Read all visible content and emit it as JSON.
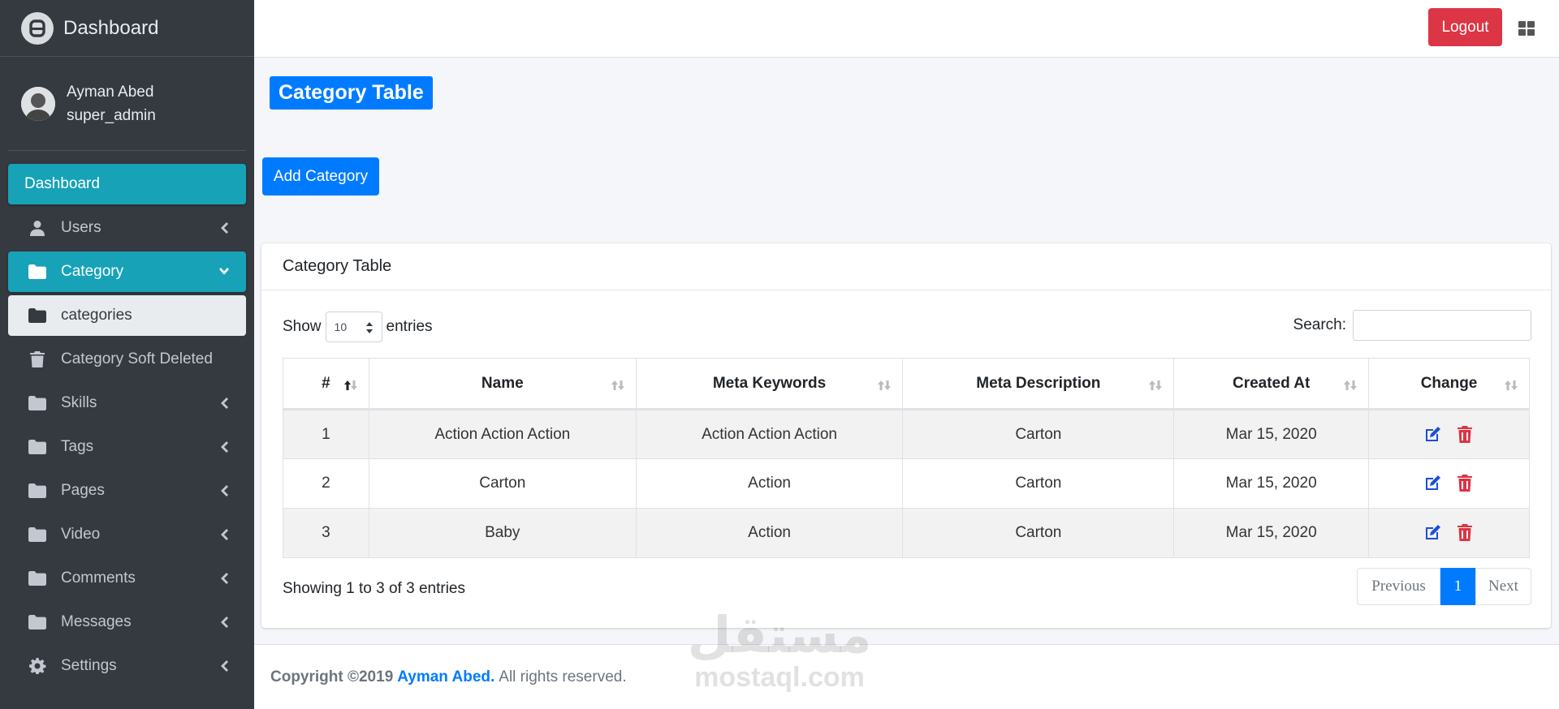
{
  "brand": {
    "name": "Dashboard"
  },
  "user": {
    "name": "Ayman Abed",
    "role": "super_admin"
  },
  "sidebar": {
    "items": [
      {
        "label": "Dashboard"
      },
      {
        "label": "Users"
      },
      {
        "label": "Category"
      },
      {
        "label": "categories"
      },
      {
        "label": "Category Soft Deleted"
      },
      {
        "label": "Skills"
      },
      {
        "label": "Tags"
      },
      {
        "label": "Pages"
      },
      {
        "label": "Video"
      },
      {
        "label": "Comments"
      },
      {
        "label": "Messages"
      },
      {
        "label": "Settings"
      }
    ]
  },
  "header": {
    "logout_label": "Logout"
  },
  "main": {
    "title": "Category Table",
    "add_label": "Add Category",
    "card_title": "Category Table",
    "show_label": "Show",
    "entries_label": "entries",
    "page_length": "10",
    "search_label": "Search:",
    "columns": [
      "#",
      "Name",
      "Meta Keywords",
      "Meta Description",
      "Created At",
      "Change"
    ],
    "rows": [
      {
        "id": "1",
        "name": "Action Action Action",
        "keywords": "Action Action Action",
        "description": "Carton",
        "created": "Mar 15, 2020"
      },
      {
        "id": "2",
        "name": "Carton",
        "keywords": "Action",
        "description": "Carton",
        "created": "Mar 15, 2020"
      },
      {
        "id": "3",
        "name": "Baby",
        "keywords": "Action",
        "description": "Carton",
        "created": "Mar 15, 2020"
      }
    ],
    "info": "Showing 1 to 3 of 3 entries",
    "pagination": {
      "prev": "Previous",
      "current": "1",
      "next": "Next"
    }
  },
  "footer": {
    "copyright": "Copyright ©2019",
    "author": "Ayman Abed.",
    "rights": "All rights reserved."
  },
  "watermark": {
    "arabic": "مستقل",
    "latin": "mostaql.com"
  },
  "colors": {
    "sidebar_bg": "#343a40",
    "active_item": "#17a2b8",
    "primary": "#007bff",
    "danger": "#dc3545"
  }
}
